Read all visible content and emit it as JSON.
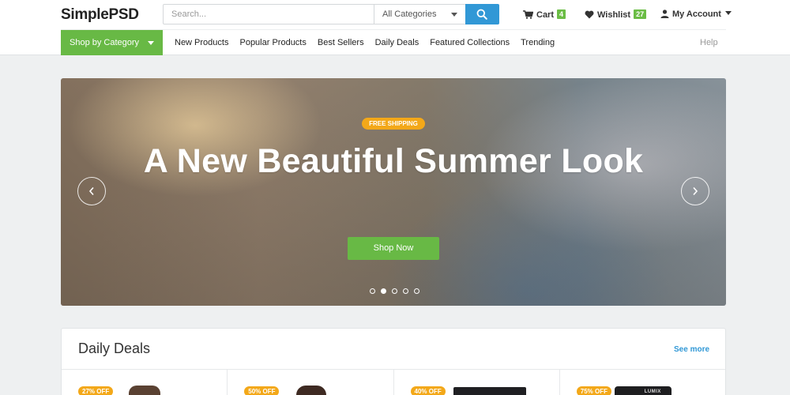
{
  "header": {
    "logo": "SimplePSD",
    "search": {
      "placeholder": "Search...",
      "category": "All Categories"
    },
    "cart": {
      "label": "Cart",
      "count": "4"
    },
    "wishlist": {
      "label": "Wishlist",
      "count": "27"
    },
    "account": {
      "label": "My Account"
    }
  },
  "nav": {
    "shop_by_category": "Shop by Category",
    "links": [
      "New Products",
      "Popular Products",
      "Best Sellers",
      "Daily Deals",
      "Featured Collections",
      "Trending"
    ],
    "help": "Help"
  },
  "hero": {
    "badge": "FREE SHIPPING",
    "title": "A New Beautiful Summer Look",
    "cta": "Shop Now",
    "slide_count": 5,
    "active_slide": 2
  },
  "daily_deals": {
    "title": "Daily Deals",
    "see_more": "See more",
    "items": [
      {
        "discount": "27% OFF"
      },
      {
        "discount": "50% OFF"
      },
      {
        "discount": "40% OFF"
      },
      {
        "discount": "75% OFF",
        "brand": "LUMIX"
      }
    ]
  },
  "colors": {
    "accent_green": "#68b945",
    "accent_blue": "#3198d6",
    "badge_orange": "#f3a819"
  },
  "icons": [
    "search-icon",
    "cart-icon",
    "heart-icon",
    "user-icon",
    "chevron-left-icon",
    "chevron-right-icon",
    "chevron-down-icon"
  ]
}
